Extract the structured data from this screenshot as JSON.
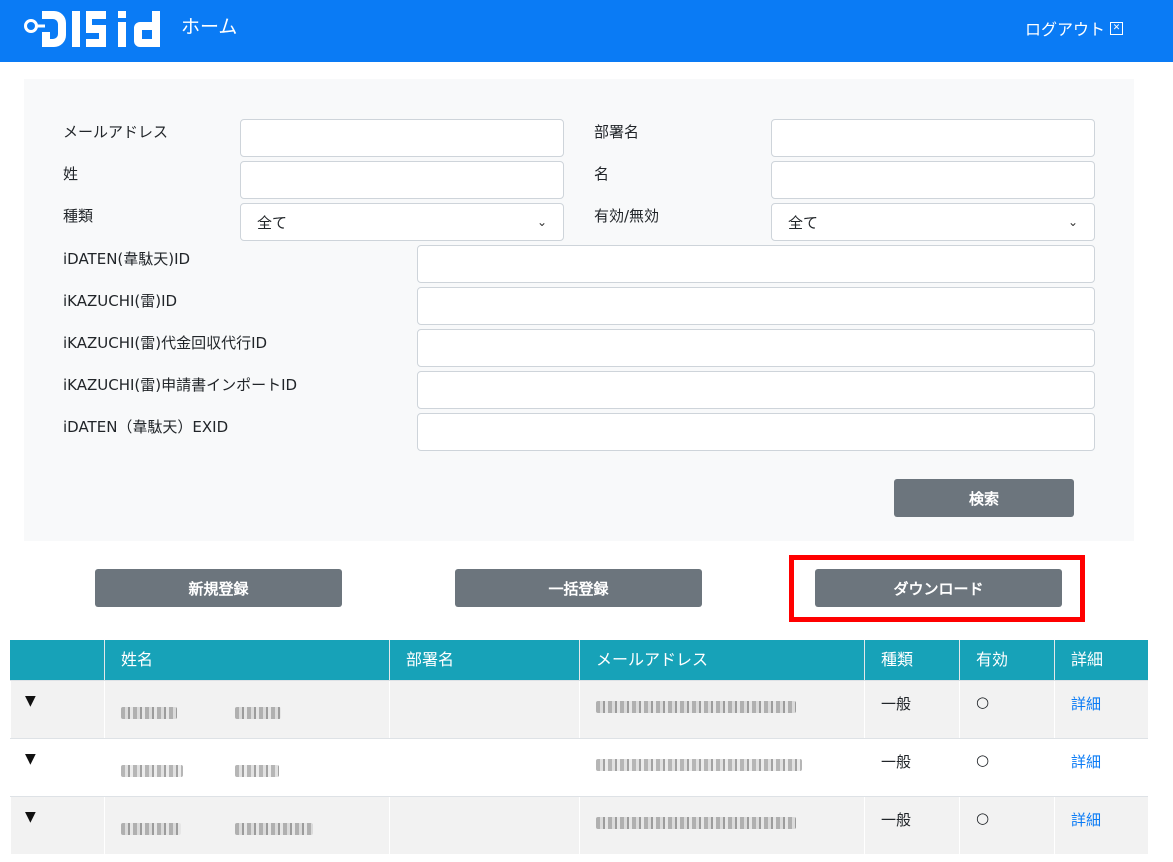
{
  "header": {
    "logo_text": "DIS iD",
    "page_title": "ホーム",
    "logout_label": "ログアウト"
  },
  "search": {
    "email_label": "メールアドレス",
    "email_value": "",
    "department_label": "部署名",
    "department_value": "",
    "last_name_label": "姓",
    "last_name_value": "",
    "first_name_label": "名",
    "first_name_value": "",
    "type_label": "種類",
    "type_selected": "全て",
    "active_label": "有効/無効",
    "active_selected": "全て",
    "idaten_id_label": "iDATEN(韋駄天)ID",
    "idaten_id_value": "",
    "ikazuchi_id_label": "iKAZUCHI(雷)ID",
    "ikazuchi_id_value": "",
    "ikazuchi_collect_label": "iKAZUCHI(雷)代金回収代行ID",
    "ikazuchi_collect_value": "",
    "ikazuchi_import_label": "iKAZUCHI(雷)申請書インポートID",
    "ikazuchi_import_value": "",
    "idaten_exid_label": "iDATEN（韋駄天）EXID",
    "idaten_exid_value": "",
    "search_button": "検索"
  },
  "actions": {
    "new_register": "新規登録",
    "bulk_register": "一括登録",
    "download": "ダウンロード"
  },
  "table": {
    "columns": [
      "",
      "姓名",
      "部署名",
      "メールアドレス",
      "種類",
      "有効",
      "詳細"
    ],
    "rows": [
      {
        "toggle": "▼",
        "type": "一般",
        "active": "○",
        "detail": "詳細"
      },
      {
        "toggle": "▼",
        "type": "一般",
        "active": "○",
        "detail": "詳細"
      },
      {
        "toggle": "▼",
        "type": "一般",
        "active": "○",
        "detail": "詳細"
      }
    ]
  },
  "colors": {
    "header_bg": "#0a7bf5",
    "table_header_bg": "#17a2b8",
    "button_gray": "#6c757d",
    "highlight_red": "#ff0000"
  }
}
